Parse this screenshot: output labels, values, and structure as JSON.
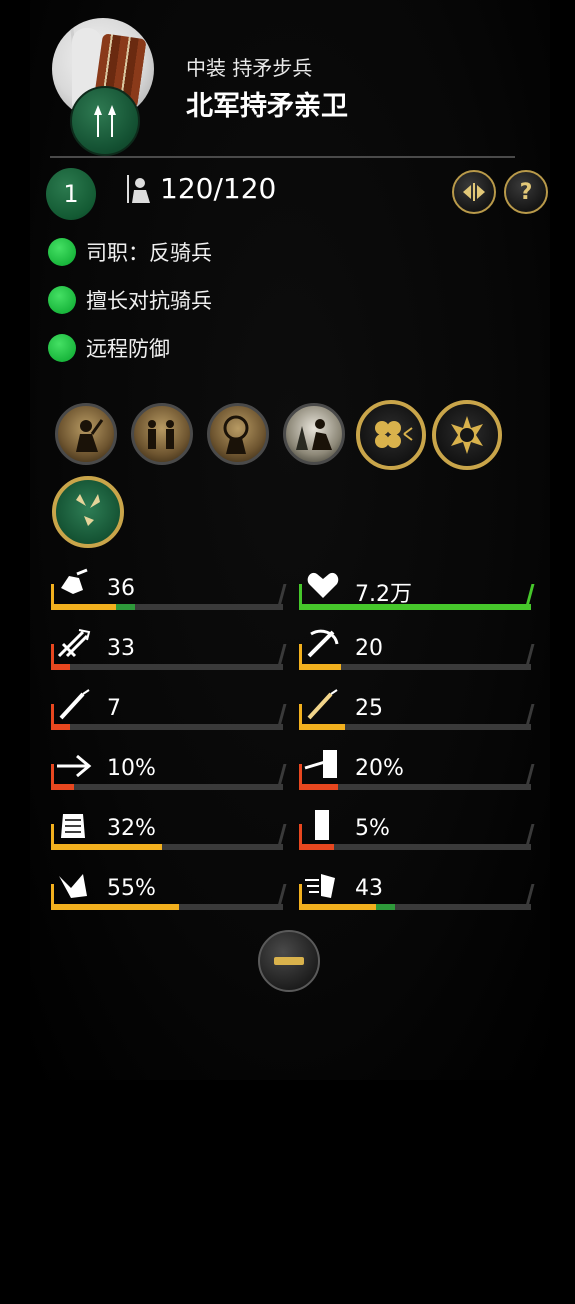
{
  "unit": {
    "subtitle": "中装 持矛步兵",
    "title": "北军持矛亲卫",
    "level": "1",
    "troops": "120/120"
  },
  "traits": [
    {
      "label": "司职：反骑兵"
    },
    {
      "label": "擅长对抗骑兵"
    },
    {
      "label": "远程防御"
    }
  ],
  "header_buttons": {
    "compare_icon": "compare-icon",
    "help_label": "?"
  },
  "skills": [
    {
      "icon": "rally-soldier-icon"
    },
    {
      "icon": "formation-soldiers-icon"
    },
    {
      "icon": "shield-wall-icon"
    },
    {
      "icon": "forest-charge-icon"
    },
    {
      "icon": "spread-formation-icon"
    },
    {
      "icon": "brace-icon"
    },
    {
      "icon": "caltrops-icon"
    }
  ],
  "stats": [
    {
      "name": "morale",
      "value": "36",
      "icon": "morale-icon",
      "fill": 0.28,
      "color": "#f2b01e",
      "extra": 0.08
    },
    {
      "name": "health",
      "value": "7.2万",
      "icon": "heart-icon",
      "fill": 1.0,
      "color": "#46c72b"
    },
    {
      "name": "melee-attack",
      "value": "33",
      "icon": "melee-attack-icon",
      "fill": 0.08,
      "color": "#e8471f"
    },
    {
      "name": "melee-defense",
      "value": "20",
      "icon": "melee-defense-icon",
      "fill": 0.18,
      "color": "#f2b01e"
    },
    {
      "name": "weapon-damage",
      "value": "7",
      "icon": "weapon-damage-icon",
      "fill": 0.08,
      "color": "#e8471f"
    },
    {
      "name": "armor-piercing",
      "value": "25",
      "icon": "armor-piercing-icon",
      "fill": 0.2,
      "color": "#f2b01e"
    },
    {
      "name": "charge-bonus",
      "value": "10%",
      "icon": "charge-bonus-icon",
      "fill": 0.1,
      "color": "#e8471f"
    },
    {
      "name": "shield-block",
      "value": "20%",
      "icon": "shield-block-icon",
      "fill": 0.17,
      "color": "#e8471f"
    },
    {
      "name": "armor",
      "value": "32%",
      "icon": "armor-icon",
      "fill": 0.48,
      "color": "#f2b01e"
    },
    {
      "name": "ranged-block",
      "value": "5%",
      "icon": "ranged-block-icon",
      "fill": 0.15,
      "color": "#e8471f"
    },
    {
      "name": "discipline",
      "value": "55%",
      "icon": "discipline-icon",
      "fill": 0.55,
      "color": "#f2b01e"
    },
    {
      "name": "speed",
      "value": "43",
      "icon": "speed-icon",
      "fill": 0.33,
      "color": "#f2b01e",
      "extra": 0.08
    }
  ],
  "collapse": {
    "icon": "collapse-icon"
  }
}
